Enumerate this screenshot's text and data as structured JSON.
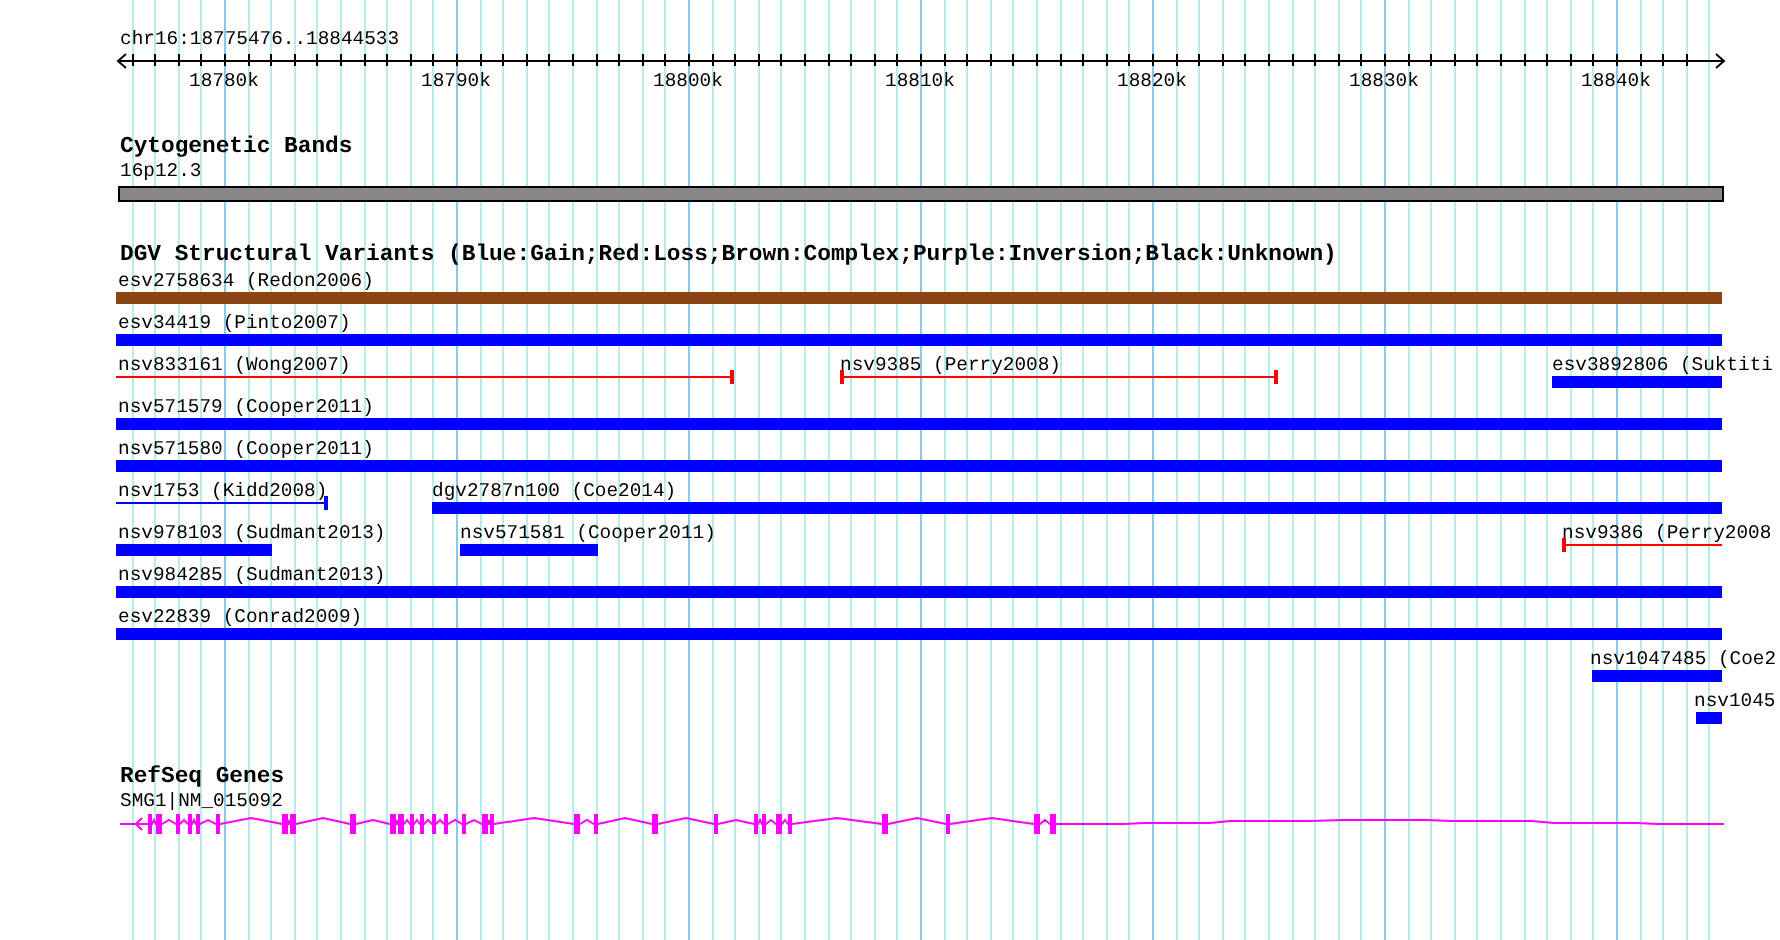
{
  "ruler": {
    "position": "chr16:18775476..18844533",
    "ticks": [
      "18780k",
      "18790k",
      "18800k",
      "18810k",
      "18820k",
      "18830k",
      "18840k"
    ]
  },
  "cytogenetic_bands": {
    "title": "Cytogenetic Bands",
    "band": "16p12.3"
  },
  "dgv": {
    "title": "DGV Structural Variants (Blue:Gain;Red:Loss;Brown:Complex;Purple:Inversion;Black:Unknown)",
    "rows": [
      {
        "features": [
          {
            "label": "esv2758634 (Redon2006)",
            "kind": "bar",
            "color": "#8b4513"
          }
        ]
      },
      {
        "features": [
          {
            "label": "esv34419 (Pinto2007)",
            "kind": "bar",
            "color": "#0000ff"
          }
        ]
      },
      {
        "features": [
          {
            "label": "nsv833161 (Wong2007)",
            "kind": "line",
            "color": "#ff0000"
          },
          {
            "label": "nsv9385 (Perry2008)",
            "kind": "line",
            "color": "#ff0000"
          },
          {
            "label": "esv3892806 (Suktiti",
            "kind": "bar",
            "color": "#0000ff"
          }
        ]
      },
      {
        "features": [
          {
            "label": "nsv571579 (Cooper2011)",
            "kind": "bar",
            "color": "#0000ff"
          }
        ]
      },
      {
        "features": [
          {
            "label": "nsv571580 (Cooper2011)",
            "kind": "bar",
            "color": "#0000ff"
          }
        ]
      },
      {
        "features": [
          {
            "label": "nsv1753 (Kidd2008)",
            "kind": "line",
            "color": "#0000ff"
          },
          {
            "label": "dgv2787n100 (Coe2014)",
            "kind": "bar",
            "color": "#0000ff"
          }
        ]
      },
      {
        "features": [
          {
            "label": "nsv978103 (Sudmant2013)",
            "kind": "bar",
            "color": "#0000ff"
          },
          {
            "label": "nsv571581 (Cooper2011)",
            "kind": "bar",
            "color": "#0000ff"
          },
          {
            "label": "nsv9386 (Perry2008",
            "kind": "line",
            "color": "#ff0000"
          }
        ]
      },
      {
        "features": [
          {
            "label": "nsv984285 (Sudmant2013)",
            "kind": "bar",
            "color": "#0000ff"
          }
        ]
      },
      {
        "features": [
          {
            "label": "esv22839 (Conrad2009)",
            "kind": "bar",
            "color": "#0000ff"
          }
        ]
      },
      {
        "features": [
          {
            "label": "nsv1047485 (Coe2",
            "kind": "bar",
            "color": "#0000ff"
          }
        ]
      },
      {
        "features": [
          {
            "label": "nsv1045",
            "kind": "bar",
            "color": "#0000ff"
          }
        ]
      }
    ]
  },
  "refseq": {
    "title": "RefSeq Genes",
    "gene": "SMG1|NM_015092"
  }
}
